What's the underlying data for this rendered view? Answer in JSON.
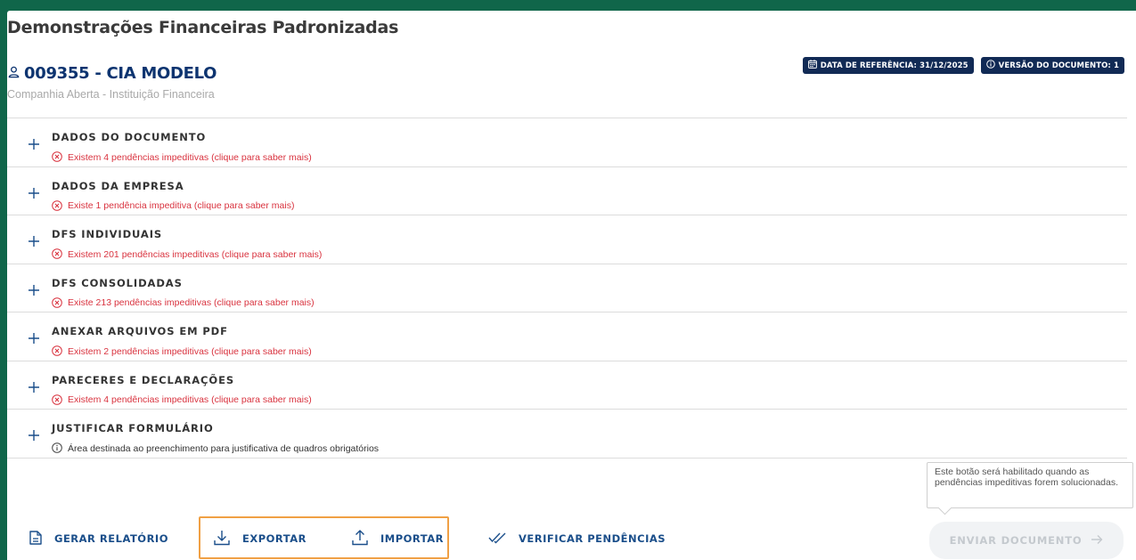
{
  "page": {
    "title": "Demonstrações Financeiras Padronizadas"
  },
  "company": {
    "name": "009355 - CIA MODELO",
    "subtitle": "Companhia Aberta - Instituição Financeira",
    "icon": "user-icon"
  },
  "badges": [
    {
      "label": "DATA DE REFERÊNCIA: 31/12/2025",
      "icon": "calendar-icon"
    },
    {
      "label": "VERSÃO DO DOCUMENTO: 1",
      "icon": "info-icon"
    }
  ],
  "sections": [
    {
      "title": "DADOS DO DOCUMENTO",
      "status": "Existem 4 pendências impeditivas (clique para saber mais)",
      "type": "error"
    },
    {
      "title": "DADOS DA EMPRESA",
      "status": "Existe 1 pendência impeditiva (clique para saber mais)",
      "type": "error"
    },
    {
      "title": "DFS INDIVIDUAIS",
      "status": "Existem 201 pendências impeditivas (clique para saber mais)",
      "type": "error"
    },
    {
      "title": "DFS CONSOLIDADAS",
      "status": "Existe 213 pendências impeditivas (clique para saber mais)",
      "type": "error"
    },
    {
      "title": "ANEXAR ARQUIVOS EM PDF",
      "status": "Existem 2 pendências impeditivas (clique para saber mais)",
      "type": "error"
    },
    {
      "title": "PARECERES E DECLARAÇÕES",
      "status": "Existem 4 pendências impeditivas (clique para saber mais)",
      "type": "error"
    },
    {
      "title": "JUSTIFICAR FORMULÁRIO",
      "status": "Área destinada ao preenchimento para justificativa de quadros obrigatórios",
      "type": "info"
    }
  ],
  "footer": {
    "report_label": "GERAR RELATÓRIO",
    "export_label": "EXPORTAR",
    "import_label": "IMPORTAR",
    "verify_label": "VERIFICAR PENDÊNCIAS",
    "send_label": "ENVIAR DOCUMENTO",
    "tooltip": "Este botão será habilitado quando as pendências impeditivas forem solucionadas."
  },
  "colors": {
    "background": "#10664a",
    "title_blue": "#0d3470",
    "badge_bg": "#112a55",
    "error_red": "#d9333f",
    "info_gray": "#333333",
    "action_blue": "#1a4e8a",
    "highlight_orange": "#f0a044",
    "disabled_gray": "#c4c9ce"
  }
}
